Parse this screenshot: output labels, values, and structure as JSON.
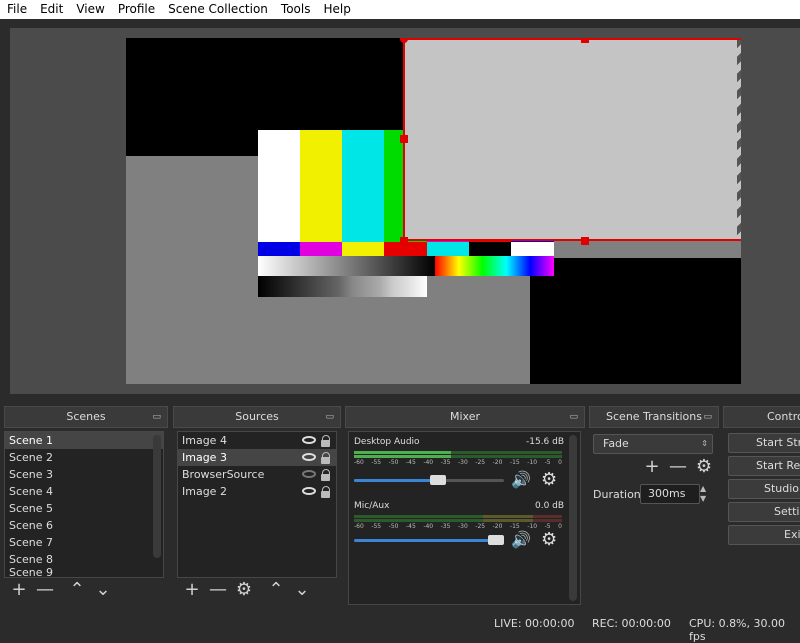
{
  "menu": [
    "File",
    "Edit",
    "View",
    "Profile",
    "Scene Collection",
    "Tools",
    "Help"
  ],
  "docks": {
    "scenes": "Scenes",
    "sources": "Sources",
    "mixer": "Mixer",
    "transitions": "Scene Transitions",
    "controls": "Controls"
  },
  "scenes": [
    "Scene 1",
    "Scene 2",
    "Scene 3",
    "Scene 4",
    "Scene 5",
    "Scene 6",
    "Scene 7",
    "Scene 8",
    "Scene 9"
  ],
  "sources": [
    {
      "name": "Image 4",
      "visible": true
    },
    {
      "name": "Image 3",
      "visible": true
    },
    {
      "name": "BrowserSource",
      "visible": false
    },
    {
      "name": "Image 2",
      "visible": true
    }
  ],
  "mixer": {
    "channels": [
      {
        "name": "Desktop Audio",
        "db": "-15.6 dB",
        "volume": 0.55
      },
      {
        "name": "Mic/Aux",
        "db": "0.0 dB",
        "volume": 1.0
      }
    ],
    "ticks": [
      "-60",
      "-55",
      "-50",
      "-45",
      "-40",
      "-35",
      "-30",
      "-25",
      "-20",
      "-15",
      "-10",
      "-5",
      "0"
    ]
  },
  "transitions": {
    "selected": "Fade",
    "duration_label": "Duration",
    "duration": "300ms"
  },
  "controls": [
    "Start Streaming",
    "Start Recording",
    "Studio Mode",
    "Settings",
    "Exit"
  ],
  "status": {
    "live": "LIVE: 00:00:00",
    "rec": "REC: 00:00:00",
    "cpu": "CPU: 0.8%, 30.00 fps"
  },
  "colors": {
    "selection": "#e00000",
    "meter_green": "#4caf50",
    "meter_yellow": "#c8c832",
    "meter_red": "#c83232",
    "slider": "#3a86d4"
  }
}
